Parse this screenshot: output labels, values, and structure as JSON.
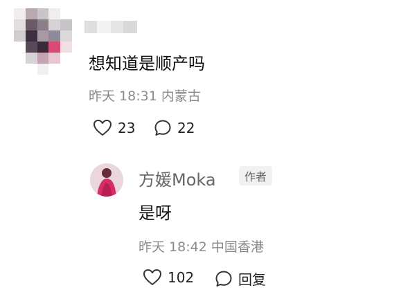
{
  "comment": {
    "text": "想知道是顺产吗",
    "meta": "昨天 18:31 内蒙古",
    "likes": "23",
    "replies": "22"
  },
  "reply": {
    "author": "方媛Moka",
    "badge": "作者",
    "text": "是呀",
    "meta": "昨天 18:42 中国香港",
    "likes": "102",
    "reply_label": "回复"
  },
  "icons": {
    "like": "heart-outline-icon",
    "comment": "speech-bubble-icon"
  },
  "colors": {
    "text_primary": "#111111",
    "text_meta": "#8a8a8a",
    "author_name": "#666666",
    "badge_bg": "#f1f1f1"
  }
}
